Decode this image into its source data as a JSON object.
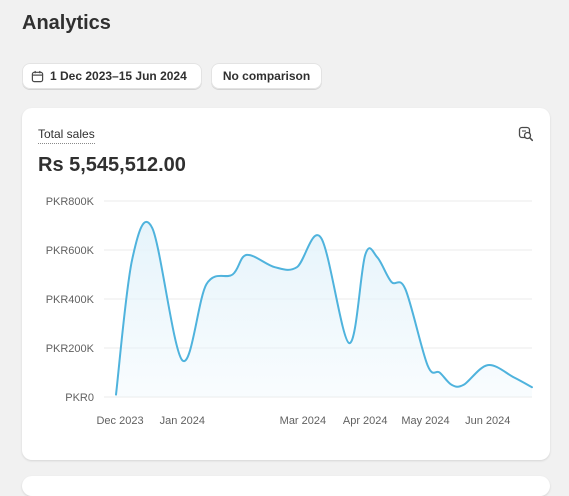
{
  "page": {
    "title": "Analytics"
  },
  "filters": {
    "date_range": "1 Dec 2023–15 Jun 2024",
    "comparison": "No comparison"
  },
  "card": {
    "title": "Total sales",
    "value": "Rs 5,545,512.00",
    "explore_icon": "explore-search-icon"
  },
  "colors": {
    "line": "#4fb3dd",
    "fill": "#e6f4fb",
    "grid": "#ebebeb"
  },
  "chart_data": {
    "type": "area",
    "title": "Total sales",
    "xlabel": "",
    "ylabel": "",
    "ylim": [
      0,
      800000
    ],
    "y_ticks": [
      {
        "value": 0,
        "label": "PKR0"
      },
      {
        "value": 200000,
        "label": "PKR200K"
      },
      {
        "value": 400000,
        "label": "PKR400K"
      },
      {
        "value": 600000,
        "label": "PKR600K"
      },
      {
        "value": 800000,
        "label": "PKR800K"
      }
    ],
    "x_ticks": [
      {
        "date": "2023-12-01",
        "label": "Dec 2023"
      },
      {
        "date": "2024-01-01",
        "label": "Jan 2024"
      },
      {
        "date": "2024-03-01",
        "label": "Mar 2024"
      },
      {
        "date": "2024-04-01",
        "label": "Apr 2024"
      },
      {
        "date": "2024-05-01",
        "label": "May 2024"
      },
      {
        "date": "2024-06-01",
        "label": "Jun 2024"
      }
    ],
    "x_range": [
      "2023-11-29",
      "2024-06-23"
    ],
    "grid": true,
    "legend": "none",
    "series": [
      {
        "x": [
          "2023-11-29",
          "2023-12-07",
          "2023-12-17",
          "2024-01-01",
          "2024-01-13",
          "2024-01-26",
          "2024-02-02",
          "2024-02-16",
          "2024-02-27",
          "2024-03-10",
          "2024-03-24",
          "2024-04-01",
          "2024-04-07",
          "2024-04-14",
          "2024-04-21",
          "2024-05-02",
          "2024-05-08",
          "2024-05-14",
          "2024-05-20",
          "2024-06-01",
          "2024-06-14",
          "2024-06-23"
        ],
        "y": [
          10000,
          560000,
          690000,
          150000,
          460000,
          500000,
          580000,
          530000,
          530000,
          650000,
          220000,
          580000,
          570000,
          470000,
          440000,
          130000,
          100000,
          50000,
          50000,
          130000,
          80000,
          40000
        ]
      }
    ]
  }
}
